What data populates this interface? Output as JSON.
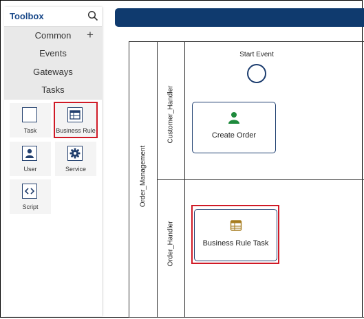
{
  "toolbox": {
    "title": "Toolbox",
    "search_icon": "search-icon",
    "groups": [
      {
        "label": "Common"
      },
      {
        "label": "Events"
      },
      {
        "label": "Gateways"
      },
      {
        "label": "Tasks"
      }
    ],
    "add_icon": "plus-icon",
    "tools": [
      {
        "label": "Task",
        "icon": "task-icon"
      },
      {
        "label": "Business Rule",
        "icon": "business-rule-icon"
      },
      {
        "label": "User",
        "icon": "user-icon"
      },
      {
        "label": "Service",
        "icon": "gear-icon"
      },
      {
        "label": "Script",
        "icon": "script-icon"
      }
    ]
  },
  "diagram": {
    "pool_name": "Order_Management",
    "lanes": [
      {
        "name": "Customer_Handler"
      },
      {
        "name": "Order_Handler"
      }
    ],
    "start_event_label": "Start Event",
    "tasks": [
      {
        "label": "Create Order",
        "icon": "user-icon"
      },
      {
        "label": "Business Rule Task",
        "icon": "business-rule-icon"
      }
    ]
  },
  "colors": {
    "brand": "#0f3a6e",
    "highlight": "#d01a26",
    "user_icon": "#1e8a3c",
    "business_rule_icon": "#a67c1e"
  }
}
